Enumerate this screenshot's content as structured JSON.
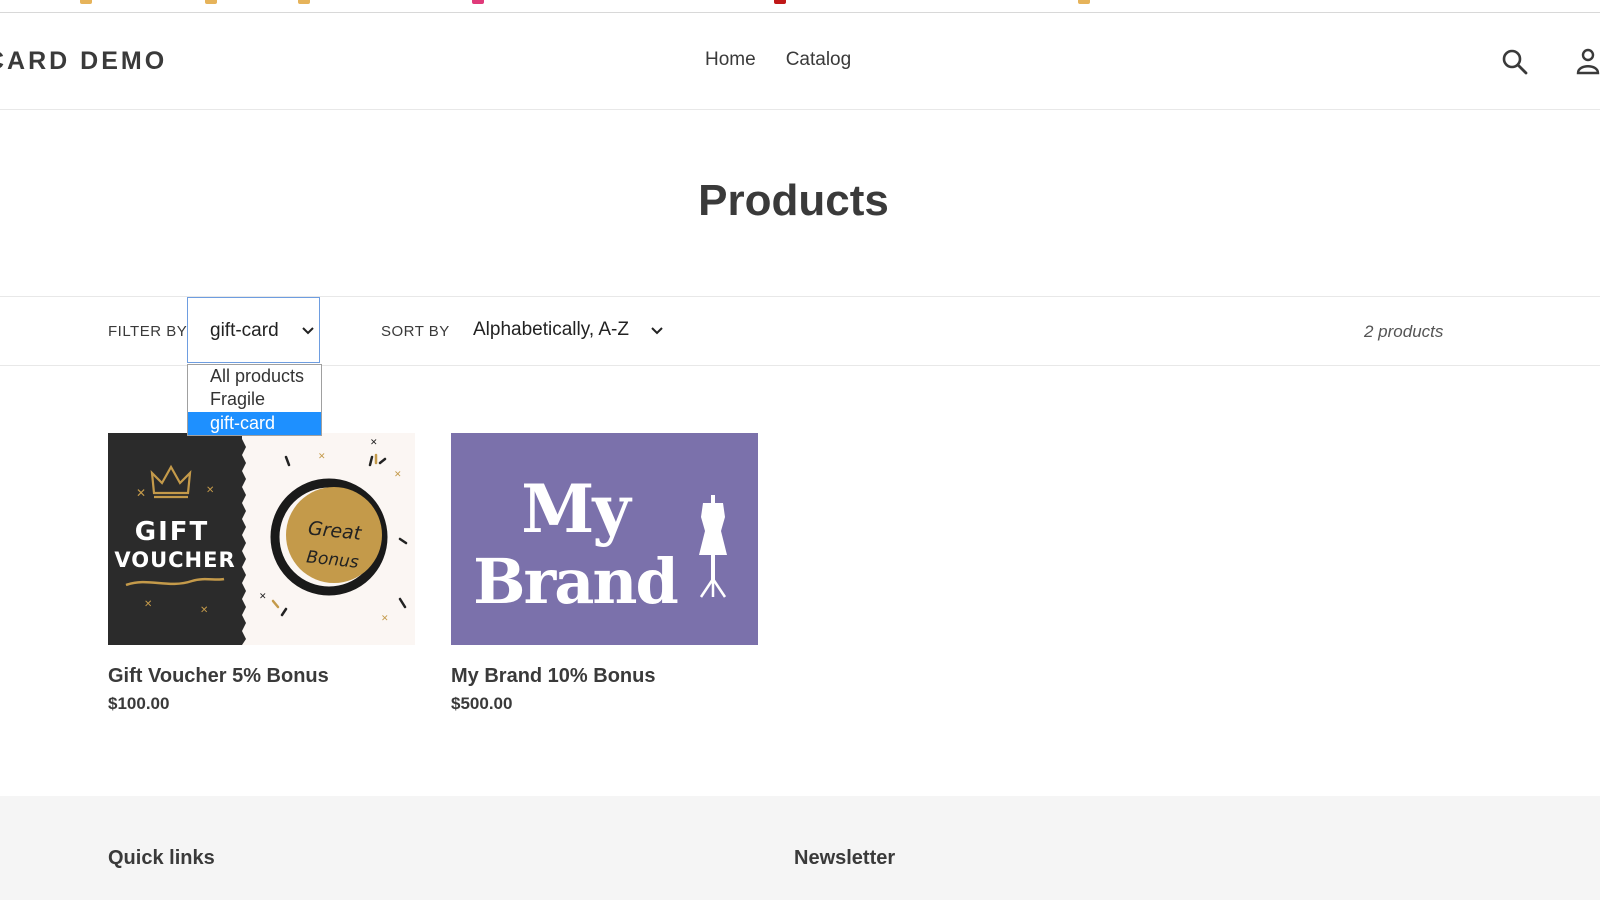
{
  "header": {
    "logo": "CARD DEMO",
    "nav": [
      {
        "label": "Home"
      },
      {
        "label": "Catalog"
      }
    ]
  },
  "page_title": "Products",
  "filters": {
    "filter_label": "FILTER BY",
    "filter_value": "gift-card",
    "filter_options": [
      {
        "label": "All products",
        "selected": false
      },
      {
        "label": "Fragile",
        "selected": false
      },
      {
        "label": "gift-card",
        "selected": true
      }
    ],
    "sort_label": "SORT BY",
    "sort_value": "Alphabetically, A-Z",
    "product_count": "2 products"
  },
  "products": [
    {
      "name": "Gift Voucher 5% Bonus",
      "price": "$100.00",
      "image": {
        "left_text_1": "GIFT",
        "left_text_2": "VOUCHER",
        "right_text_1": "Great",
        "right_text_2": "Bonus"
      }
    },
    {
      "name": "My Brand 10% Bonus",
      "price": "$500.00",
      "image": {
        "text_1": "My",
        "text_2": "Brand"
      }
    }
  ],
  "footer": {
    "quick_links_heading": "Quick links",
    "newsletter_heading": "Newsletter"
  },
  "colors": {
    "text": "#3a3a3a",
    "selected_option": "#1e90ff",
    "voucher_dark": "#2b2b2b",
    "voucher_gold": "#c49a4a",
    "brand_purple": "#7b71ab",
    "footer_bg": "#f5f5f5"
  },
  "icons": [
    "search-icon",
    "account-icon",
    "chevron-down-icon",
    "crown-icon",
    "mannequin-icon"
  ]
}
